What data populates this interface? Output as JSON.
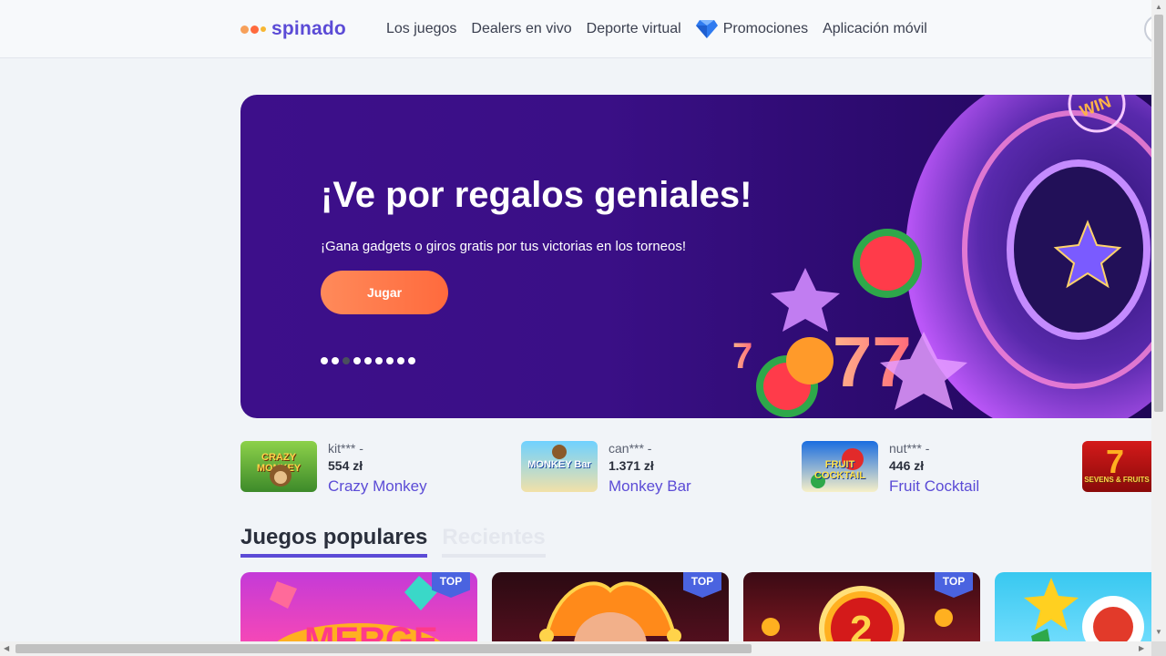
{
  "brand": {
    "name": "spinado",
    "accent": "#5b4bd6",
    "logo_colors": [
      "#ff8a5a",
      "#ff6a3d",
      "#f7b733"
    ]
  },
  "nav": {
    "items": [
      {
        "label": "Los juegos"
      },
      {
        "label": "Dealers en vivo"
      },
      {
        "label": "Deporte virtual"
      },
      {
        "label": "Promociones",
        "icon": "diamond-icon"
      },
      {
        "label": "Aplicación móvil"
      }
    ]
  },
  "banner": {
    "title": "¡Ve por regalos geniales!",
    "subtitle": "¡Gana gadgets o giros gratis por tus victorias en los torneos!",
    "button": "Jugar",
    "slides_total": 9,
    "active_slide": 3
  },
  "winners": [
    {
      "user": "kit*** -",
      "amount": "554 zł",
      "game": "Crazy Monkey",
      "thumb_label": "CRAZY MONKEY"
    },
    {
      "user": "can*** -",
      "amount": "1.371 zł",
      "game": "Monkey Bar",
      "thumb_label": "MONKEY Bar"
    },
    {
      "user": "nut*** -",
      "amount": "446 zł",
      "game": "Fruit Cocktail",
      "thumb_label": "FRUIT COCKTAIL"
    },
    {
      "thumb_label": "SEVENS & FRUITS"
    }
  ],
  "tabs": [
    {
      "label": "Juegos populares",
      "active": true
    },
    {
      "label": "Recientes",
      "active": false
    }
  ],
  "games": [
    {
      "badge": "TOP"
    },
    {
      "badge": "TOP"
    },
    {
      "badge": "TOP"
    },
    {
      "badge": ""
    }
  ]
}
